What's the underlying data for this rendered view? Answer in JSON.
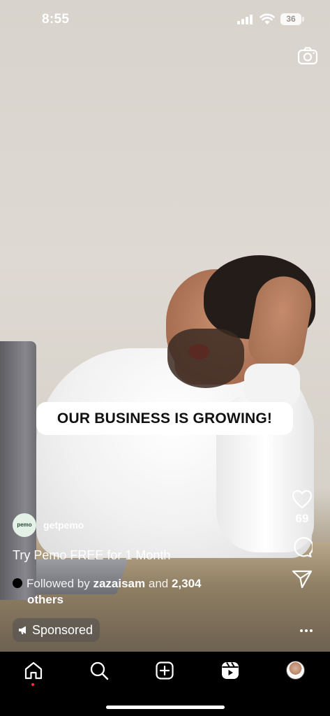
{
  "status_bar": {
    "time": "8:55",
    "battery": "36"
  },
  "video": {
    "caption_overlay": "OUR BUSINESS IS GROWING!"
  },
  "author": {
    "avatar_text": "pemo",
    "username": "getpemo"
  },
  "post": {
    "caption": "Try Pemo FREE for 1 Month",
    "followed_prefix": "Followed by",
    "followed_user": "zazaisam",
    "followed_and": "and",
    "followed_count": "2,304",
    "followed_suffix": "others",
    "sponsored_label": "Sponsored"
  },
  "actions": {
    "like_count": "69"
  },
  "icons": {
    "camera": "camera-icon",
    "like": "heart-icon",
    "comment": "comment-icon",
    "share": "send-icon",
    "more": "more-dots-icon",
    "home": "home-icon",
    "search": "search-icon",
    "create": "plus-square-icon",
    "reels": "reels-icon",
    "sponsored": "megaphone-icon"
  },
  "colors": {
    "notification_dot": "#ff2d3c",
    "caption_pill_bg": "#ffffff"
  }
}
